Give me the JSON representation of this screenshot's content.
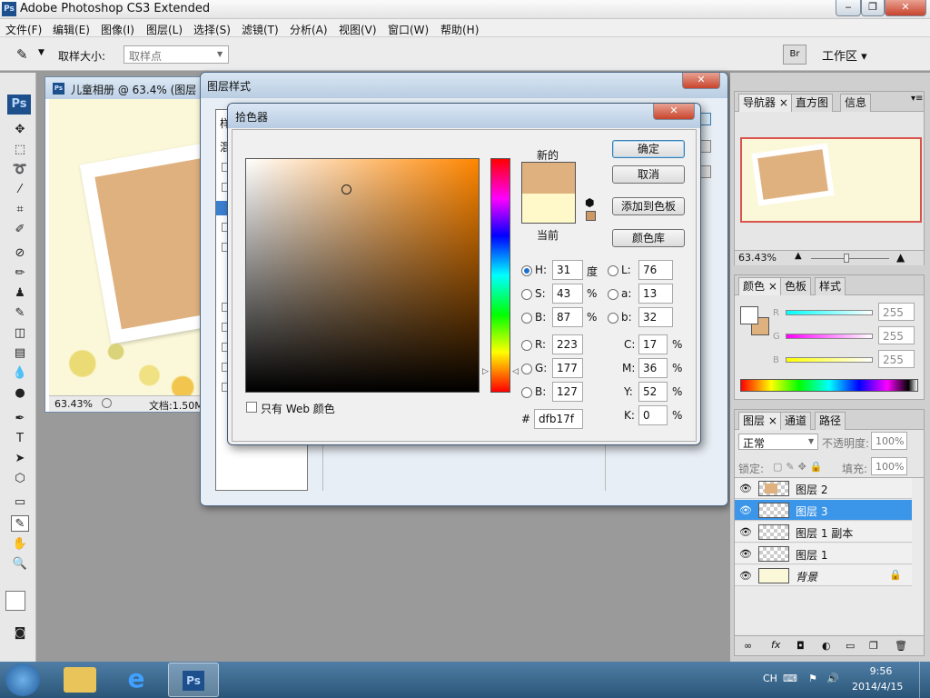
{
  "app": {
    "title": "Adobe Photoshop CS3 Extended",
    "ps_badge": "Ps"
  },
  "window_controls": {
    "minimize": "‒",
    "restore": "❐",
    "close": "✕"
  },
  "menu": [
    "文件(F)",
    "编辑(E)",
    "图像(I)",
    "图层(L)",
    "选择(S)",
    "滤镜(T)",
    "分析(A)",
    "视图(V)",
    "窗口(W)",
    "帮助(H)"
  ],
  "options": {
    "sample_size_label": "取样大小:",
    "sample_size_value": "取样点",
    "workspace_label": "工作区"
  },
  "document": {
    "title": "儿童相册 @ 63.4% (图层",
    "zoom": "63.43%",
    "doc_size": "文档:1.50M"
  },
  "layer_style_dialog": {
    "title": "图层样式",
    "partial_labels": [
      "样",
      "混"
    ]
  },
  "color_picker": {
    "title": "拾色器",
    "new_label": "新的",
    "current_label": "当前",
    "ok": "确定",
    "cancel": "取消",
    "add_swatch": "添加到色板",
    "color_library": "颜色库",
    "web_only": "只有 Web 颜色",
    "new_color": "#dfb17f",
    "current_color": "#fff8c8",
    "hue_color": "#ff8600",
    "hsb": {
      "H": "31",
      "H_unit": "度",
      "S": "43",
      "S_unit": "%",
      "B": "87",
      "B_unit": "%"
    },
    "lab": {
      "L": "76",
      "a": "13",
      "b": "32"
    },
    "rgb": {
      "R": "223",
      "G": "177",
      "B": "127"
    },
    "cmyk": {
      "C": "17",
      "M": "36",
      "Y": "52",
      "K": "0",
      "unit": "%"
    },
    "hex_label": "#",
    "hex": "dfb17f"
  },
  "navigator_panel": {
    "tabs": [
      "导航器",
      "直方图",
      "信息"
    ],
    "zoom": "63.43%"
  },
  "color_panel": {
    "tabs": [
      "颜色",
      "色板",
      "样式"
    ],
    "channels": [
      {
        "label": "R",
        "value": "255"
      },
      {
        "label": "G",
        "value": "255"
      },
      {
        "label": "B",
        "value": "255"
      }
    ]
  },
  "layers_panel": {
    "tabs": [
      "图层",
      "通道",
      "路径"
    ],
    "blend_mode": "正常",
    "opacity_label": "不透明度:",
    "opacity": "100%",
    "lock_label": "锁定:",
    "fill_label": "填充:",
    "fill": "100%",
    "layers": [
      {
        "name": "图层 2",
        "selected": false
      },
      {
        "name": "图层 3",
        "selected": true
      },
      {
        "name": "图层 1 副本",
        "selected": false
      },
      {
        "name": "图层 1",
        "selected": false
      },
      {
        "name": "背景",
        "selected": false
      }
    ]
  },
  "taskbar": {
    "lang": "CH",
    "time": "9:56",
    "date": "2014/4/15",
    "ps_badge": "Ps"
  }
}
